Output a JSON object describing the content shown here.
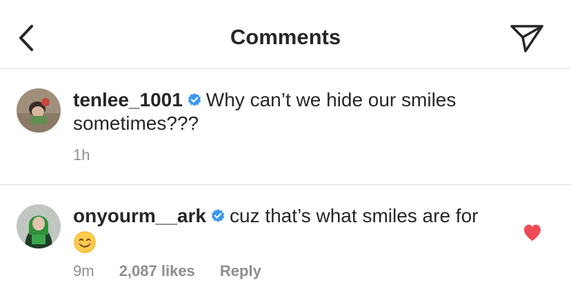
{
  "header": {
    "title": "Comments"
  },
  "caption": {
    "username": "tenlee_1001",
    "text": "Why can’t we hide our smiles sometimes???",
    "time": "1h"
  },
  "comment": {
    "username": "onyourm__ark",
    "text": "cuz that’s what smiles are for",
    "time": "9m",
    "likes": "2,087 likes",
    "reply": "Reply"
  },
  "colors": {
    "verified": "#3897f0",
    "heart": "#ed4956",
    "secondary_text": "#8e8e8e",
    "divider": "#dbdbdb"
  },
  "icons": {
    "back": "chevron-left-icon",
    "send": "paper-plane-icon",
    "verified": "verified-badge-icon",
    "heart": "heart-icon",
    "emoji": "smiling-face-emoji"
  }
}
